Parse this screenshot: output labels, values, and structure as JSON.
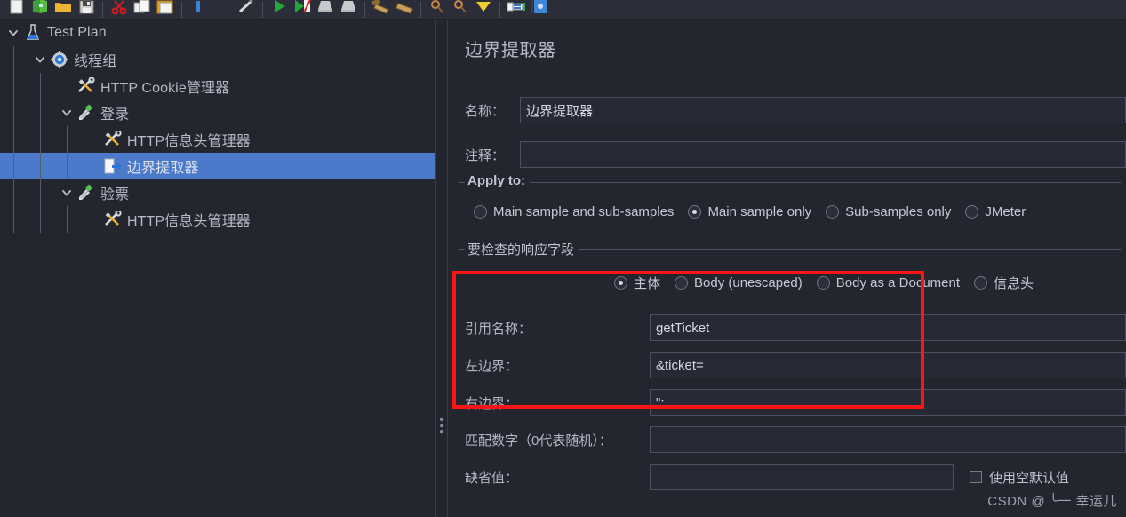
{
  "toolbar": {
    "items": [
      {
        "name": "new-file-icon",
        "tip": "新建"
      },
      {
        "name": "templates-icon",
        "tip": "模板"
      },
      {
        "name": "open-folder-icon",
        "tip": "打开"
      },
      {
        "name": "save-icon",
        "tip": "保存"
      },
      {
        "name": "separator-1",
        "tip": ""
      },
      {
        "name": "cut-icon",
        "tip": "剪切"
      },
      {
        "name": "copy-icon",
        "tip": "复制"
      },
      {
        "name": "paste-icon",
        "tip": "粘贴"
      },
      {
        "name": "separator-2",
        "tip": ""
      },
      {
        "name": "delete-icon",
        "tip": "删除"
      },
      {
        "name": "gap-1",
        "tip": ""
      },
      {
        "name": "toggle-icon",
        "tip": "启用/禁用"
      },
      {
        "name": "separator-3",
        "tip": ""
      },
      {
        "name": "start-icon",
        "tip": "启动"
      },
      {
        "name": "start-no-pauses-icon",
        "tip": "无间隔启动"
      },
      {
        "name": "stop-icon",
        "tip": "停止"
      },
      {
        "name": "shutdown-icon",
        "tip": "关闭"
      },
      {
        "name": "separator-4",
        "tip": ""
      },
      {
        "name": "clear-icon",
        "tip": "清除"
      },
      {
        "name": "clear-all-icon",
        "tip": "清除全部"
      },
      {
        "name": "separator-5",
        "tip": ""
      },
      {
        "name": "search-icon",
        "tip": "搜索"
      },
      {
        "name": "search-reset-icon",
        "tip": "重置搜索"
      },
      {
        "name": "expand-icon",
        "tip": "展开"
      },
      {
        "name": "separator-6",
        "tip": ""
      },
      {
        "name": "function-helper-icon",
        "tip": "函数助手"
      },
      {
        "name": "help-icon",
        "tip": "帮助"
      }
    ]
  },
  "tree": {
    "nodes": [
      {
        "label": "Test Plan",
        "depth": 0,
        "icon": "test-plan-icon",
        "twisty": "down",
        "selected": false
      },
      {
        "label": "线程组",
        "depth": 1,
        "icon": "thread-group-icon",
        "twisty": "down",
        "selected": false
      },
      {
        "label": "HTTP Cookie管理器",
        "depth": 2,
        "icon": "config-icon",
        "twisty": "none",
        "selected": false
      },
      {
        "label": "登录",
        "depth": 2,
        "icon": "sampler-icon",
        "twisty": "down",
        "selected": false
      },
      {
        "label": "HTTP信息头管理器",
        "depth": 3,
        "icon": "config-icon",
        "twisty": "none",
        "selected": false
      },
      {
        "label": "边界提取器",
        "depth": 3,
        "icon": "post-processor-icon",
        "twisty": "none",
        "selected": true
      },
      {
        "label": "验票",
        "depth": 2,
        "icon": "sampler-icon",
        "twisty": "down",
        "selected": false
      },
      {
        "label": "HTTP信息头管理器",
        "depth": 3,
        "icon": "config-icon",
        "twisty": "none",
        "selected": false
      }
    ]
  },
  "detail": {
    "title": "边界提取器",
    "name_label": "名称：",
    "name_value": "边界提取器",
    "comment_label": "注释：",
    "comment_value": "",
    "apply_to": {
      "group_title": "Apply to:",
      "options": [
        {
          "label": "Main sample and sub-samples",
          "selected": false
        },
        {
          "label": "Main sample only",
          "selected": true
        },
        {
          "label": "Sub-samples only",
          "selected": false
        },
        {
          "label": "JMeter",
          "selected": false
        }
      ]
    },
    "response_field": {
      "group_title": "要检查的响应字段",
      "options": [
        {
          "label": "主体",
          "selected": true
        },
        {
          "label": "Body (unescaped)",
          "selected": false
        },
        {
          "label": "Body as a Document",
          "selected": false
        },
        {
          "label": "信息头",
          "selected": false
        }
      ]
    },
    "fields": [
      {
        "label": "引用名称：",
        "value": "getTicket"
      },
      {
        "label": "左边界：",
        "value": "&ticket="
      },
      {
        "label": "右边界：",
        "value": "\";"
      },
      {
        "label": "匹配数字（0代表随机）：",
        "value": ""
      },
      {
        "label": "缺省值：",
        "value": ""
      }
    ],
    "use_empty_default": {
      "label": "使用空默认值",
      "checked": false
    }
  },
  "watermark": "CSDN @ ╰一 幸运儿",
  "colors": {
    "background": "#23252f",
    "toolbar_bg": "#2b2d38",
    "selection": "#4a7ac9",
    "text": "#b6b9c4",
    "highlight_box": "#ff1414",
    "input_border": "#4c5061"
  }
}
